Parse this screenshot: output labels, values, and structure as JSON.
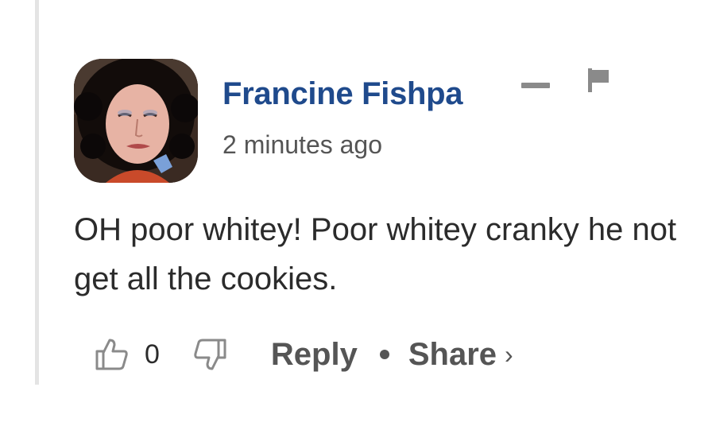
{
  "comment": {
    "author": "Francine Fishpa",
    "timestamp": "2 minutes ago",
    "body": "OH poor whitey! Poor whitey cranky he not get all the cookies.",
    "avatar_icon": "user-avatar-photo"
  },
  "actions": {
    "like_count": "0",
    "reply_label": "Reply",
    "share_label": "Share",
    "share_chevron": "›"
  },
  "icons": {
    "collapse": "minus-icon",
    "flag": "flag-icon",
    "like": "thumbs-up-icon",
    "dislike": "thumbs-down-icon"
  },
  "colors": {
    "author": "#1f4a8c",
    "muted": "#555555",
    "text": "#2b2b2b",
    "icon": "#8a8a8a"
  }
}
